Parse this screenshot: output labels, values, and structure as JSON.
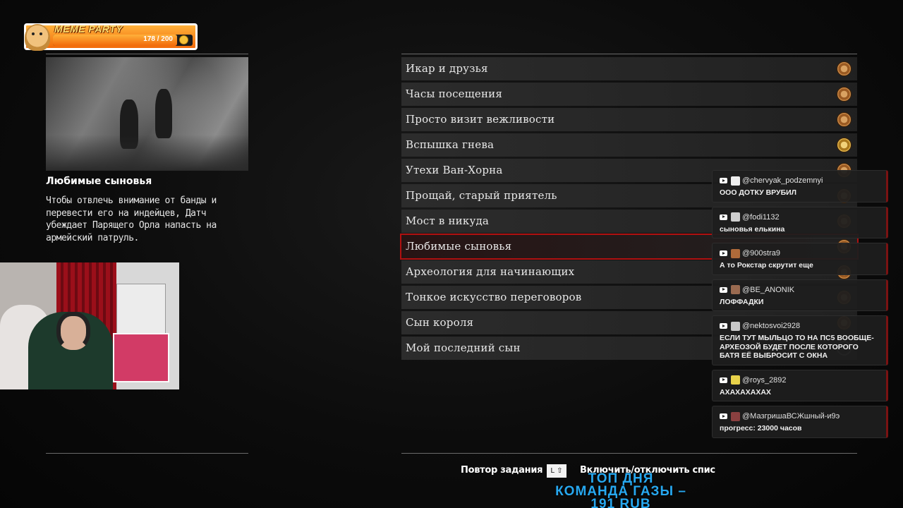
{
  "overlay": {
    "meme_party": {
      "title": "MEME PARTY",
      "count_text": "178 / 200",
      "progress": 0.89
    },
    "top_day_text": "ТОП ДНЯ\nКОМАНДА ГАЗЫ –\n191 RUB"
  },
  "mission": {
    "title": "Любимые сыновья",
    "description": "Чтобы отвлечь внимание от банды и перевести его на индейцев, Датч убеждает Парящего Орла напасть на армейский патруль."
  },
  "missions": [
    {
      "label": "Икар и друзья",
      "medal": "bronze"
    },
    {
      "label": "Часы посещения",
      "medal": "bronze"
    },
    {
      "label": "Просто визит вежливости",
      "medal": "bronze"
    },
    {
      "label": "Вспышка гнева",
      "medal": "gold"
    },
    {
      "label": "Утехи Ван-Хорна",
      "medal": "bronze"
    },
    {
      "label": "Прощай, старый приятель",
      "medal": "bronze"
    },
    {
      "label": "Мост в никуда",
      "medal": "bronze"
    },
    {
      "label": "Любимые сыновья",
      "medal": "bronze",
      "selected": true
    },
    {
      "label": "Археология для начинающих",
      "medal": "bronze"
    },
    {
      "label": "Тонкое искусство переговоров",
      "medal": "bronze"
    },
    {
      "label": "Сын короля",
      "medal": "bronze"
    },
    {
      "label": "Мой последний сын",
      "medal": "empty"
    }
  ],
  "hints": {
    "replay_label": "Повтор задания",
    "replay_key": "L ⇧",
    "toggle_label": "Включить/отключить спис"
  },
  "chat": [
    {
      "user": "@chervyak_podzemnyi",
      "text": "ООО ДОТКУ ВРУБИЛ"
    },
    {
      "user": "@fodi1132",
      "text": "сыновья елькина"
    },
    {
      "user": "@900stra9",
      "text": "А то Рокстар скрутит еще"
    },
    {
      "user": "@BE_ANONIK",
      "text": "ЛОФФАДКИ"
    },
    {
      "user": "@nektosvoi2928",
      "text": "ЕСЛИ ТУТ МЫЛЬЦО ТО НА ПС5 ВООБЩЕ-АРХЕОЗОЙ БУДЕТ ПОСЛЕ КОТОРОГО БАТЯ ЕЁ ВЫБРОСИТ С ОКНА"
    },
    {
      "user": "@roys_2892",
      "text": "АХАХАХАХАХ"
    },
    {
      "user": "@МазгришаВСЖшный-и9э",
      "text": "прогресс: 23000 часов"
    }
  ],
  "colors": {
    "accent_red": "#b01010",
    "meme_orange": "#f26a0a",
    "top_day_blue": "#27a8f0"
  }
}
